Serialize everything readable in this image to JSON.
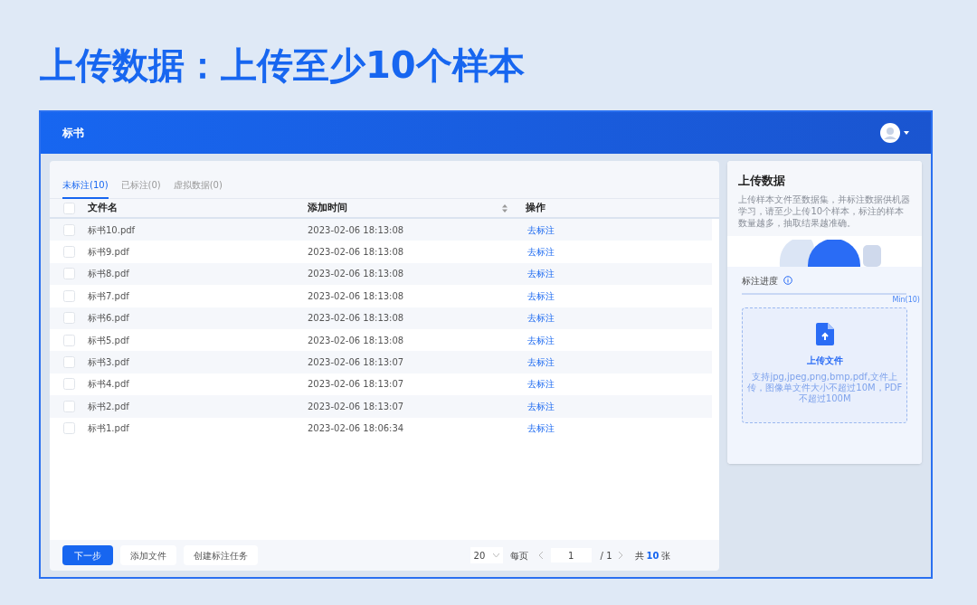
{
  "headline": "上传数据：上传至少10个样本",
  "app": {
    "title": "标书"
  },
  "tabs": [
    {
      "label": "未标注(10)",
      "selected": true
    },
    {
      "label": "已标注(0)",
      "selected": false
    },
    {
      "label": "虚拟数据(0)",
      "selected": false
    }
  ],
  "table": {
    "select_all_checked": false,
    "columns": [
      "文件名",
      "添加时间",
      "操作"
    ],
    "rows": [
      {
        "name": "标书10.pdf",
        "time": "2023-02-06 18:13:08",
        "action": "去标注",
        "checked": false
      },
      {
        "name": "标书9.pdf",
        "time": "2023-02-06 18:13:08",
        "action": "去标注",
        "checked": false
      },
      {
        "name": "标书8.pdf",
        "time": "2023-02-06 18:13:08",
        "action": "去标注",
        "checked": false
      },
      {
        "name": "标书7.pdf",
        "time": "2023-02-06 18:13:08",
        "action": "去标注",
        "checked": false
      },
      {
        "name": "标书6.pdf",
        "time": "2023-02-06 18:13:08",
        "action": "去标注",
        "checked": false
      },
      {
        "name": "标书5.pdf",
        "time": "2023-02-06 18:13:08",
        "action": "去标注",
        "checked": false
      },
      {
        "name": "标书3.pdf",
        "time": "2023-02-06 18:13:07",
        "action": "去标注",
        "checked": false
      },
      {
        "name": "标书4.pdf",
        "time": "2023-02-06 18:13:07",
        "action": "去标注",
        "checked": false
      },
      {
        "name": "标书2.pdf",
        "time": "2023-02-06 18:13:07",
        "action": "去标注",
        "checked": false
      },
      {
        "name": "标书1.pdf",
        "time": "2023-02-06 18:06:34",
        "action": "去标注",
        "checked": false
      }
    ]
  },
  "buttons": [
    {
      "label": "下一步",
      "kind": "primary"
    },
    {
      "label": "添加文件",
      "kind": "default"
    },
    {
      "label": "创建标注任务",
      "kind": "default"
    }
  ],
  "pagination": {
    "page_size": "20",
    "per_page": "每页",
    "page": "1",
    "pages": "/ 1",
    "total_prefix": "共",
    "total_count": "10",
    "total_suffix": "张"
  },
  "panel": {
    "title": "上传数据",
    "description": "上传样本文件至数据集，并标注数据供机器学习，请至少上传10个样本，标注的样本数量越多，抽取结果越准确。",
    "progress": {
      "label": "标注进度",
      "reading": "Min(10)"
    },
    "upload": {
      "title": "上传文件",
      "hint": "支持jpg,jpeg,png,bmp,pdf,文件上传，图像单文件大小不超过10M，PDF不超过100M"
    }
  }
}
